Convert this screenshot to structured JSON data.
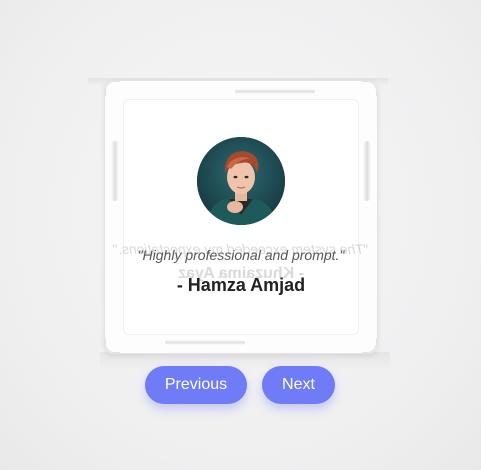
{
  "testimonial": {
    "quote": "\"Highly professional and prompt.\"",
    "author": "- Hamza Amjad",
    "ghost_quote": "\"The system exceeded my expectations.\"",
    "ghost_author": "- Khuzaima Ayaz"
  },
  "navigation": {
    "previous_label": "Previous",
    "next_label": "Next"
  },
  "colors": {
    "accent": "#6f7bf7",
    "background": "#f1f1f2",
    "card": "#ffffff",
    "quote_text": "#555555",
    "author_text": "#222222"
  },
  "icons": {
    "avatar": "user-avatar-photo"
  }
}
